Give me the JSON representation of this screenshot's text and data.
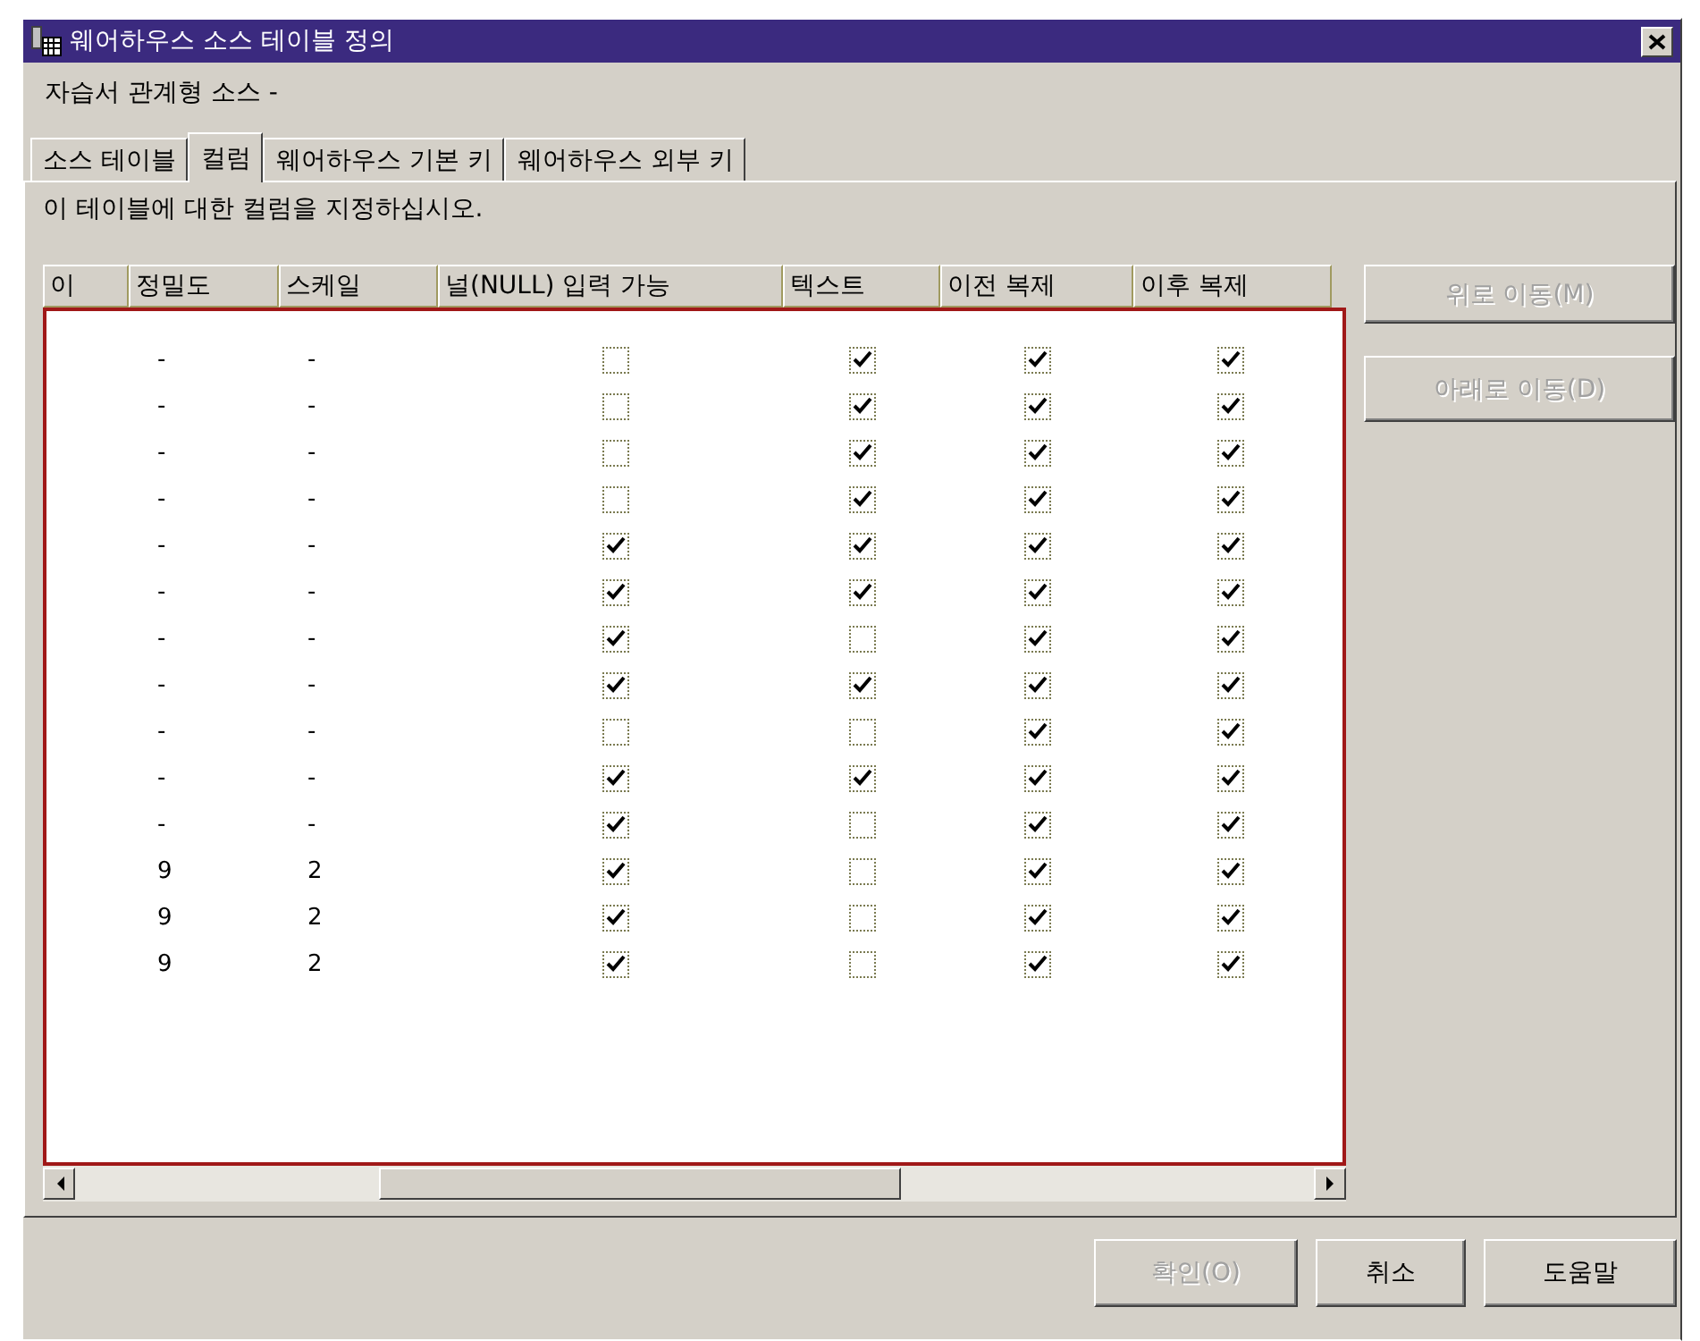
{
  "window": {
    "title": "웨어하우스 소스 테이블 정의"
  },
  "subtitle": "자습서 관계형 소스 -",
  "tabs": [
    {
      "label": "소스 테이블",
      "selected": false
    },
    {
      "label": "컬럼",
      "selected": true
    },
    {
      "label": "웨어하우스 기본 키",
      "selected": false
    },
    {
      "label": "웨어하우스 외부 키",
      "selected": false
    }
  ],
  "instruction": "이 테이블에 대한 컬럼을 지정하십시오.",
  "table": {
    "columns": [
      "이",
      "정밀도",
      "스케일",
      "널(NULL) 입력 가능",
      "텍스트",
      "이전 복제",
      "이후 복제"
    ],
    "rows": [
      {
        "precision": "-",
        "scale": "-",
        "nullable": false,
        "text": true,
        "before": true,
        "after": true
      },
      {
        "precision": "-",
        "scale": "-",
        "nullable": false,
        "text": true,
        "before": true,
        "after": true
      },
      {
        "precision": "-",
        "scale": "-",
        "nullable": false,
        "text": true,
        "before": true,
        "after": true
      },
      {
        "precision": "-",
        "scale": "-",
        "nullable": false,
        "text": true,
        "before": true,
        "after": true
      },
      {
        "precision": "-",
        "scale": "-",
        "nullable": true,
        "text": true,
        "before": true,
        "after": true
      },
      {
        "precision": "-",
        "scale": "-",
        "nullable": true,
        "text": true,
        "before": true,
        "after": true
      },
      {
        "precision": "-",
        "scale": "-",
        "nullable": true,
        "text": false,
        "before": true,
        "after": true
      },
      {
        "precision": "-",
        "scale": "-",
        "nullable": true,
        "text": true,
        "before": true,
        "after": true
      },
      {
        "precision": "-",
        "scale": "-",
        "nullable": false,
        "text": false,
        "before": true,
        "after": true
      },
      {
        "precision": "-",
        "scale": "-",
        "nullable": true,
        "text": true,
        "before": true,
        "after": true
      },
      {
        "precision": "-",
        "scale": "-",
        "nullable": true,
        "text": false,
        "before": true,
        "after": true
      },
      {
        "precision": "9",
        "scale": "2",
        "nullable": true,
        "text": false,
        "before": true,
        "after": true
      },
      {
        "precision": "9",
        "scale": "2",
        "nullable": true,
        "text": false,
        "before": true,
        "after": true
      },
      {
        "precision": "9",
        "scale": "2",
        "nullable": true,
        "text": false,
        "before": true,
        "after": true
      }
    ]
  },
  "side_buttons": [
    {
      "label": "위로 이동(M)",
      "disabled": true
    },
    {
      "label": "아래로 이동(D)",
      "disabled": true
    }
  ],
  "buttons": [
    {
      "label": "확인(O)",
      "disabled": true
    },
    {
      "label": "취소",
      "disabled": false
    },
    {
      "label": "도움말",
      "disabled": false
    }
  ]
}
